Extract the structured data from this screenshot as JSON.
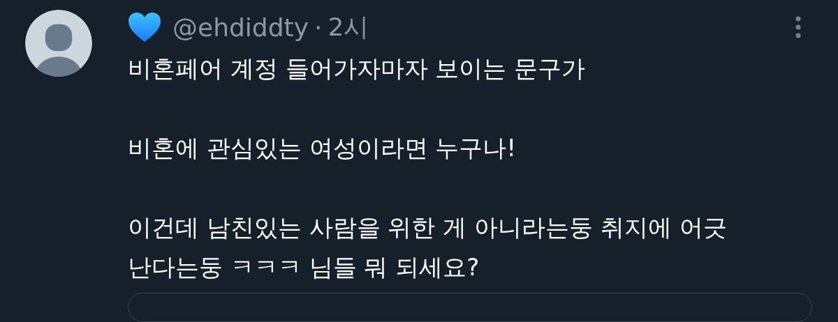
{
  "tweet": {
    "handle": "@ehdiddty",
    "separator": "·",
    "time": "2시",
    "paragraphs": [
      "비혼페어 계정 들어가자마자 보이는 문구가",
      "비혼에 관심있는 여성이라면 누구나!",
      "이건데 남친있는 사람을 위한 게 아니라는둥 취지에 어긋난다는둥 ㅋㅋㅋ 님들 뭐 되세요?"
    ]
  }
}
